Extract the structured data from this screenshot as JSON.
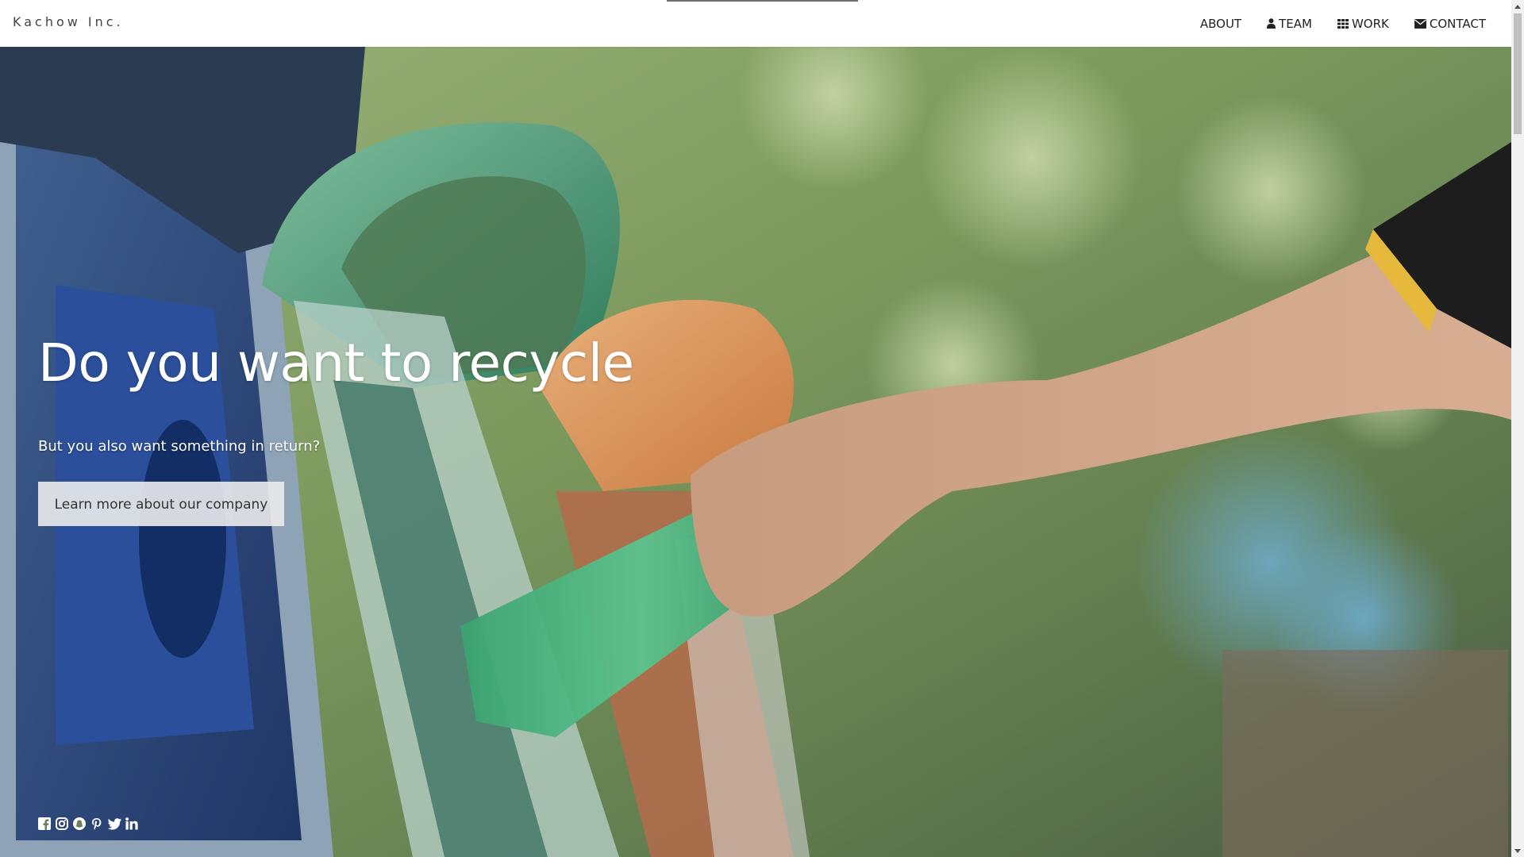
{
  "brand": "Kachow Inc.",
  "nav": [
    {
      "label": "ABOUT",
      "icon": ""
    },
    {
      "label": "TEAM",
      "icon": "user-icon"
    },
    {
      "label": "WORK",
      "icon": "grid-icon"
    },
    {
      "label": "CONTACT",
      "icon": "envelope-icon"
    }
  ],
  "hero": {
    "title": "Do you want to recycle",
    "subtitle": "But you also want something in return?",
    "button_label": "Learn more about our company",
    "background": "photo of a hand dropping a green plastic bottle into a recycling bin"
  },
  "social": [
    "facebook-icon",
    "instagram-icon",
    "snapchat-icon",
    "pinterest-icon",
    "twitter-icon",
    "linkedin-icon"
  ],
  "colors": {
    "navbar_bg": "#ffffff",
    "nav_text": "#222222",
    "hero_text": "#ffffff",
    "button_bg": "#ebebeb",
    "button_text": "#333333"
  }
}
